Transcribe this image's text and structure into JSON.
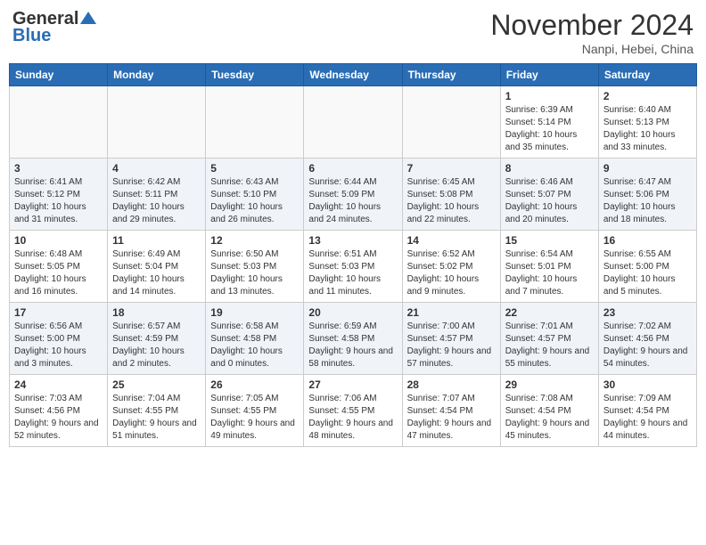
{
  "header": {
    "logo_general": "General",
    "logo_blue": "Blue",
    "month_title": "November 2024",
    "location": "Nanpi, Hebei, China"
  },
  "weekdays": [
    "Sunday",
    "Monday",
    "Tuesday",
    "Wednesday",
    "Thursday",
    "Friday",
    "Saturday"
  ],
  "weeks": [
    [
      {
        "day": "",
        "info": ""
      },
      {
        "day": "",
        "info": ""
      },
      {
        "day": "",
        "info": ""
      },
      {
        "day": "",
        "info": ""
      },
      {
        "day": "",
        "info": ""
      },
      {
        "day": "1",
        "info": "Sunrise: 6:39 AM\nSunset: 5:14 PM\nDaylight: 10 hours and 35 minutes."
      },
      {
        "day": "2",
        "info": "Sunrise: 6:40 AM\nSunset: 5:13 PM\nDaylight: 10 hours and 33 minutes."
      }
    ],
    [
      {
        "day": "3",
        "info": "Sunrise: 6:41 AM\nSunset: 5:12 PM\nDaylight: 10 hours and 31 minutes."
      },
      {
        "day": "4",
        "info": "Sunrise: 6:42 AM\nSunset: 5:11 PM\nDaylight: 10 hours and 29 minutes."
      },
      {
        "day": "5",
        "info": "Sunrise: 6:43 AM\nSunset: 5:10 PM\nDaylight: 10 hours and 26 minutes."
      },
      {
        "day": "6",
        "info": "Sunrise: 6:44 AM\nSunset: 5:09 PM\nDaylight: 10 hours and 24 minutes."
      },
      {
        "day": "7",
        "info": "Sunrise: 6:45 AM\nSunset: 5:08 PM\nDaylight: 10 hours and 22 minutes."
      },
      {
        "day": "8",
        "info": "Sunrise: 6:46 AM\nSunset: 5:07 PM\nDaylight: 10 hours and 20 minutes."
      },
      {
        "day": "9",
        "info": "Sunrise: 6:47 AM\nSunset: 5:06 PM\nDaylight: 10 hours and 18 minutes."
      }
    ],
    [
      {
        "day": "10",
        "info": "Sunrise: 6:48 AM\nSunset: 5:05 PM\nDaylight: 10 hours and 16 minutes."
      },
      {
        "day": "11",
        "info": "Sunrise: 6:49 AM\nSunset: 5:04 PM\nDaylight: 10 hours and 14 minutes."
      },
      {
        "day": "12",
        "info": "Sunrise: 6:50 AM\nSunset: 5:03 PM\nDaylight: 10 hours and 13 minutes."
      },
      {
        "day": "13",
        "info": "Sunrise: 6:51 AM\nSunset: 5:03 PM\nDaylight: 10 hours and 11 minutes."
      },
      {
        "day": "14",
        "info": "Sunrise: 6:52 AM\nSunset: 5:02 PM\nDaylight: 10 hours and 9 minutes."
      },
      {
        "day": "15",
        "info": "Sunrise: 6:54 AM\nSunset: 5:01 PM\nDaylight: 10 hours and 7 minutes."
      },
      {
        "day": "16",
        "info": "Sunrise: 6:55 AM\nSunset: 5:00 PM\nDaylight: 10 hours and 5 minutes."
      }
    ],
    [
      {
        "day": "17",
        "info": "Sunrise: 6:56 AM\nSunset: 5:00 PM\nDaylight: 10 hours and 3 minutes."
      },
      {
        "day": "18",
        "info": "Sunrise: 6:57 AM\nSunset: 4:59 PM\nDaylight: 10 hours and 2 minutes."
      },
      {
        "day": "19",
        "info": "Sunrise: 6:58 AM\nSunset: 4:58 PM\nDaylight: 10 hours and 0 minutes."
      },
      {
        "day": "20",
        "info": "Sunrise: 6:59 AM\nSunset: 4:58 PM\nDaylight: 9 hours and 58 minutes."
      },
      {
        "day": "21",
        "info": "Sunrise: 7:00 AM\nSunset: 4:57 PM\nDaylight: 9 hours and 57 minutes."
      },
      {
        "day": "22",
        "info": "Sunrise: 7:01 AM\nSunset: 4:57 PM\nDaylight: 9 hours and 55 minutes."
      },
      {
        "day": "23",
        "info": "Sunrise: 7:02 AM\nSunset: 4:56 PM\nDaylight: 9 hours and 54 minutes."
      }
    ],
    [
      {
        "day": "24",
        "info": "Sunrise: 7:03 AM\nSunset: 4:56 PM\nDaylight: 9 hours and 52 minutes."
      },
      {
        "day": "25",
        "info": "Sunrise: 7:04 AM\nSunset: 4:55 PM\nDaylight: 9 hours and 51 minutes."
      },
      {
        "day": "26",
        "info": "Sunrise: 7:05 AM\nSunset: 4:55 PM\nDaylight: 9 hours and 49 minutes."
      },
      {
        "day": "27",
        "info": "Sunrise: 7:06 AM\nSunset: 4:55 PM\nDaylight: 9 hours and 48 minutes."
      },
      {
        "day": "28",
        "info": "Sunrise: 7:07 AM\nSunset: 4:54 PM\nDaylight: 9 hours and 47 minutes."
      },
      {
        "day": "29",
        "info": "Sunrise: 7:08 AM\nSunset: 4:54 PM\nDaylight: 9 hours and 45 minutes."
      },
      {
        "day": "30",
        "info": "Sunrise: 7:09 AM\nSunset: 4:54 PM\nDaylight: 9 hours and 44 minutes."
      }
    ]
  ]
}
